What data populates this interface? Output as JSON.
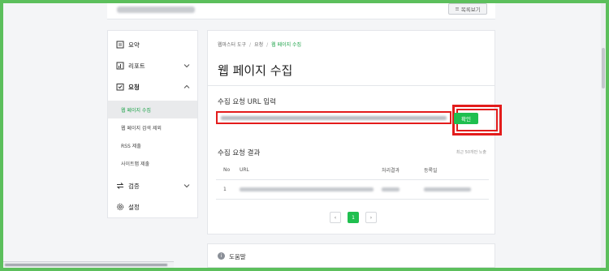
{
  "topbar": {
    "button_label": "목록보기"
  },
  "sidebar": {
    "items": [
      {
        "label": "요약",
        "icon": "home-icon"
      },
      {
        "label": "리포트",
        "icon": "report-icon"
      },
      {
        "label": "요청",
        "icon": "request-icon"
      }
    ],
    "sub_items": [
      {
        "label": "웹 페이지 수집"
      },
      {
        "label": "웹 페이지 검색 제외"
      },
      {
        "label": "RSS 제출"
      },
      {
        "label": "사이트맵 제출"
      }
    ],
    "items2": [
      {
        "label": "검증",
        "icon": "verify-icon"
      },
      {
        "label": "설정",
        "icon": "gear-icon"
      }
    ]
  },
  "breadcrumb": {
    "root": "웹마스터 도구",
    "middle": "요청",
    "current": "웹 페이지 수집"
  },
  "page_title": "웹 페이지 수집",
  "submit": {
    "section_title": "수집 요청 URL 입력",
    "button_label": "확인"
  },
  "results": {
    "section_title": "수집 요청 결과",
    "recent_note": "최근 50개만 노출",
    "columns": [
      "No",
      "URL",
      "처리결과",
      "등록일"
    ],
    "rows": [
      {
        "no": "1"
      }
    ]
  },
  "pager": {
    "prev": "‹",
    "current": "1",
    "next": "›"
  },
  "help": {
    "title": "도움말"
  },
  "colors": {
    "accent": "#1fbf4f",
    "highlight": "#e31c1c",
    "outer_frame": "#5cbf5c"
  }
}
